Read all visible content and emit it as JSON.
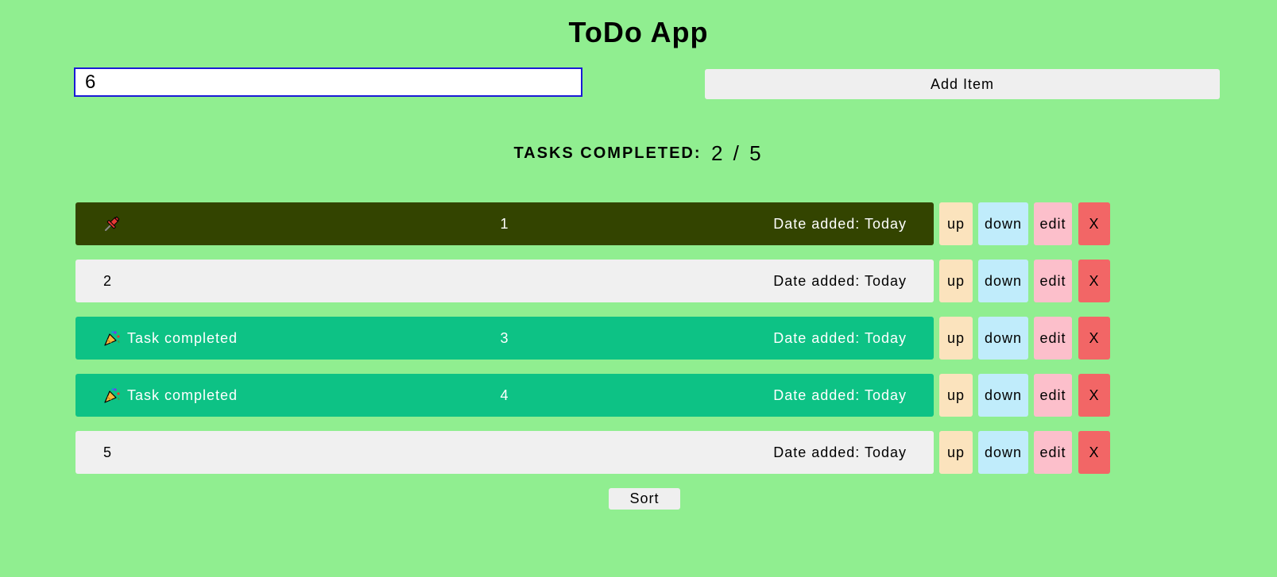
{
  "app": {
    "title": "ToDo App"
  },
  "input": {
    "value": "6"
  },
  "add_button_label": "Add Item",
  "counter": {
    "label": "Tasks completed:",
    "value": "2 / 5"
  },
  "tasks": [
    {
      "text": "1",
      "status": "",
      "date": "Date added: Today",
      "state": "pinned",
      "icon": "pushpin-icon"
    },
    {
      "text": "2",
      "status": "",
      "date": "Date added: Today",
      "state": "plain",
      "icon": ""
    },
    {
      "text": "3",
      "status": "Task completed",
      "date": "Date added: Today",
      "state": "done",
      "icon": "party-popper-icon"
    },
    {
      "text": "4",
      "status": "Task completed",
      "date": "Date added: Today",
      "state": "done",
      "icon": "party-popper-icon"
    },
    {
      "text": "5",
      "status": "",
      "date": "Date added: Today",
      "state": "plain",
      "icon": ""
    }
  ],
  "task_buttons": {
    "up": "up",
    "down": "down",
    "edit": "edit",
    "delete": "X"
  },
  "sort_button_label": "Sort",
  "colors": {
    "background": "#90ee90",
    "pinned": "#334400",
    "done": "#0dc285",
    "plain": "#f0f0f0",
    "up": "#fbe3bd",
    "down": "#c0ecfb",
    "edit": "#fcbfcb",
    "delete": "#f26666",
    "input_border": "#1a1ad6"
  }
}
